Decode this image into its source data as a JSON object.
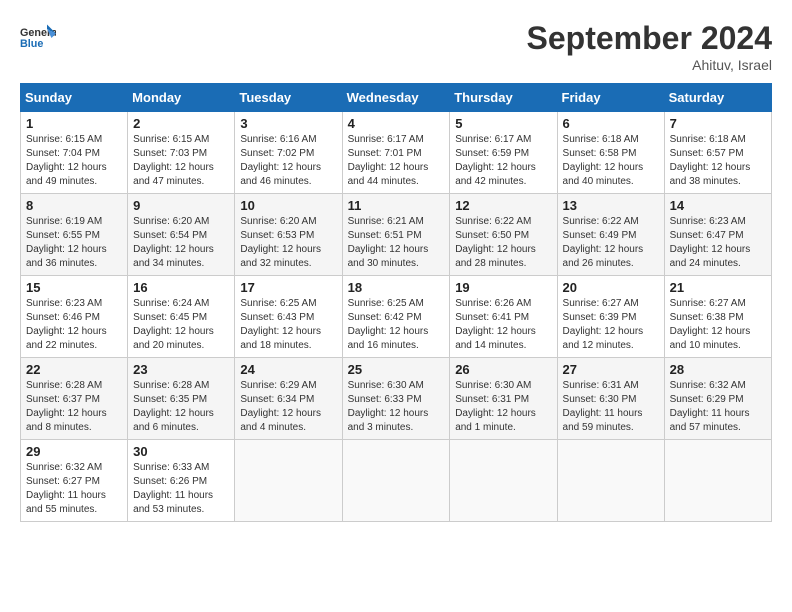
{
  "header": {
    "logo_general": "General",
    "logo_blue": "Blue",
    "month_title": "September 2024",
    "subtitle": "Ahituv, Israel"
  },
  "days_of_week": [
    "Sunday",
    "Monday",
    "Tuesday",
    "Wednesday",
    "Thursday",
    "Friday",
    "Saturday"
  ],
  "weeks": [
    [
      {
        "day": "1",
        "sunrise": "6:15 AM",
        "sunset": "7:04 PM",
        "daylight": "12 hours and 49 minutes."
      },
      {
        "day": "2",
        "sunrise": "6:15 AM",
        "sunset": "7:03 PM",
        "daylight": "12 hours and 47 minutes."
      },
      {
        "day": "3",
        "sunrise": "6:16 AM",
        "sunset": "7:02 PM",
        "daylight": "12 hours and 46 minutes."
      },
      {
        "day": "4",
        "sunrise": "6:17 AM",
        "sunset": "7:01 PM",
        "daylight": "12 hours and 44 minutes."
      },
      {
        "day": "5",
        "sunrise": "6:17 AM",
        "sunset": "6:59 PM",
        "daylight": "12 hours and 42 minutes."
      },
      {
        "day": "6",
        "sunrise": "6:18 AM",
        "sunset": "6:58 PM",
        "daylight": "12 hours and 40 minutes."
      },
      {
        "day": "7",
        "sunrise": "6:18 AM",
        "sunset": "6:57 PM",
        "daylight": "12 hours and 38 minutes."
      }
    ],
    [
      {
        "day": "8",
        "sunrise": "6:19 AM",
        "sunset": "6:55 PM",
        "daylight": "12 hours and 36 minutes."
      },
      {
        "day": "9",
        "sunrise": "6:20 AM",
        "sunset": "6:54 PM",
        "daylight": "12 hours and 34 minutes."
      },
      {
        "day": "10",
        "sunrise": "6:20 AM",
        "sunset": "6:53 PM",
        "daylight": "12 hours and 32 minutes."
      },
      {
        "day": "11",
        "sunrise": "6:21 AM",
        "sunset": "6:51 PM",
        "daylight": "12 hours and 30 minutes."
      },
      {
        "day": "12",
        "sunrise": "6:22 AM",
        "sunset": "6:50 PM",
        "daylight": "12 hours and 28 minutes."
      },
      {
        "day": "13",
        "sunrise": "6:22 AM",
        "sunset": "6:49 PM",
        "daylight": "12 hours and 26 minutes."
      },
      {
        "day": "14",
        "sunrise": "6:23 AM",
        "sunset": "6:47 PM",
        "daylight": "12 hours and 24 minutes."
      }
    ],
    [
      {
        "day": "15",
        "sunrise": "6:23 AM",
        "sunset": "6:46 PM",
        "daylight": "12 hours and 22 minutes."
      },
      {
        "day": "16",
        "sunrise": "6:24 AM",
        "sunset": "6:45 PM",
        "daylight": "12 hours and 20 minutes."
      },
      {
        "day": "17",
        "sunrise": "6:25 AM",
        "sunset": "6:43 PM",
        "daylight": "12 hours and 18 minutes."
      },
      {
        "day": "18",
        "sunrise": "6:25 AM",
        "sunset": "6:42 PM",
        "daylight": "12 hours and 16 minutes."
      },
      {
        "day": "19",
        "sunrise": "6:26 AM",
        "sunset": "6:41 PM",
        "daylight": "12 hours and 14 minutes."
      },
      {
        "day": "20",
        "sunrise": "6:27 AM",
        "sunset": "6:39 PM",
        "daylight": "12 hours and 12 minutes."
      },
      {
        "day": "21",
        "sunrise": "6:27 AM",
        "sunset": "6:38 PM",
        "daylight": "12 hours and 10 minutes."
      }
    ],
    [
      {
        "day": "22",
        "sunrise": "6:28 AM",
        "sunset": "6:37 PM",
        "daylight": "12 hours and 8 minutes."
      },
      {
        "day": "23",
        "sunrise": "6:28 AM",
        "sunset": "6:35 PM",
        "daylight": "12 hours and 6 minutes."
      },
      {
        "day": "24",
        "sunrise": "6:29 AM",
        "sunset": "6:34 PM",
        "daylight": "12 hours and 4 minutes."
      },
      {
        "day": "25",
        "sunrise": "6:30 AM",
        "sunset": "6:33 PM",
        "daylight": "12 hours and 3 minutes."
      },
      {
        "day": "26",
        "sunrise": "6:30 AM",
        "sunset": "6:31 PM",
        "daylight": "12 hours and 1 minute."
      },
      {
        "day": "27",
        "sunrise": "6:31 AM",
        "sunset": "6:30 PM",
        "daylight": "11 hours and 59 minutes."
      },
      {
        "day": "28",
        "sunrise": "6:32 AM",
        "sunset": "6:29 PM",
        "daylight": "11 hours and 57 minutes."
      }
    ],
    [
      {
        "day": "29",
        "sunrise": "6:32 AM",
        "sunset": "6:27 PM",
        "daylight": "11 hours and 55 minutes."
      },
      {
        "day": "30",
        "sunrise": "6:33 AM",
        "sunset": "6:26 PM",
        "daylight": "11 hours and 53 minutes."
      },
      null,
      null,
      null,
      null,
      null
    ]
  ]
}
